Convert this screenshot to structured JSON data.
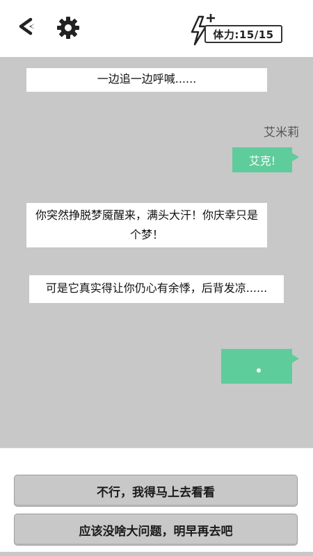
{
  "header": {
    "back_icon": "back-arrow-icon",
    "settings_icon": "gear-icon",
    "stamina_icon": "lightning-plus-icon",
    "stamina_text": "体力:15/15"
  },
  "chat": {
    "narration_1": "一边追一边呼喊......",
    "speaker_name": "艾米莉",
    "player_bubble_1": "艾克!",
    "narration_2": "你突然挣脱梦魇醒来，满头大汗！你庆幸只是个梦！",
    "narration_3": "可是它真实得让你仍心有余悸，后背发凉......",
    "player_bubble_2_icon": "typing-dot-icon"
  },
  "choices": [
    {
      "label": "不行，我得马上去看看"
    },
    {
      "label": "应该没啥大问题，明早再去吧"
    }
  ],
  "colors": {
    "chat_background": "#c8c8c8",
    "bubble_green": "#5fcc9b",
    "narration_background": "#ffffff"
  }
}
